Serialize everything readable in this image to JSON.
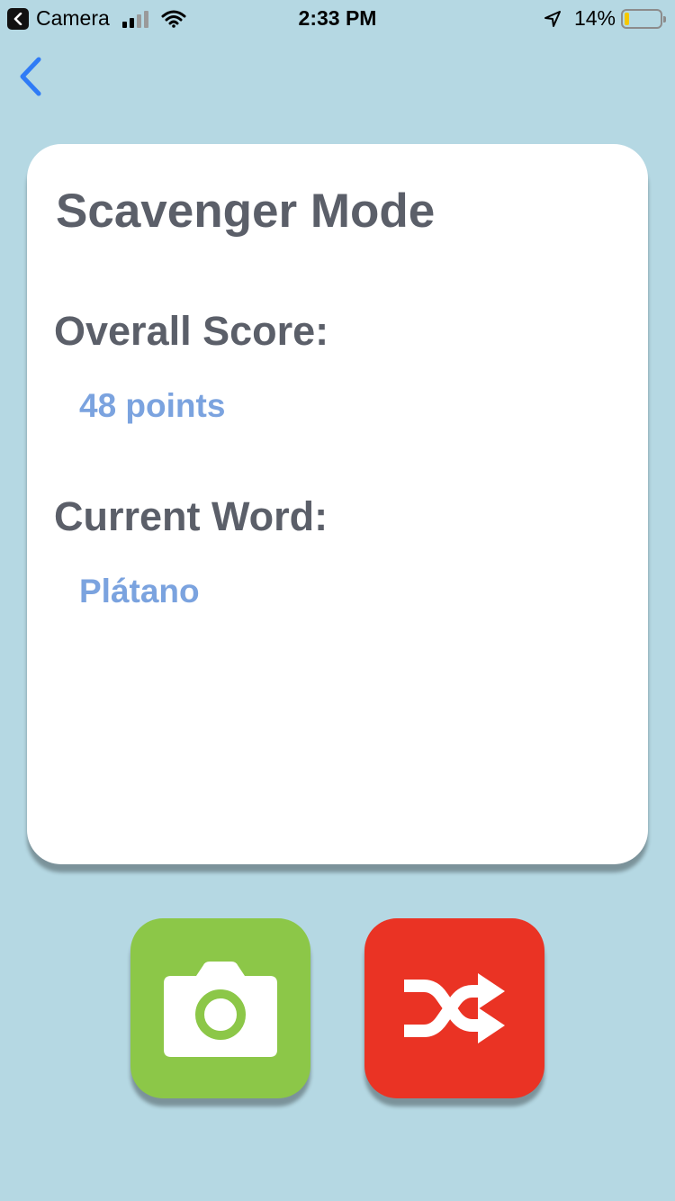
{
  "status_bar": {
    "back_app": "Camera",
    "time": "2:33 PM",
    "battery": "14%",
    "battery_level": 0.14,
    "battery_color": "#f5c800"
  },
  "nav": {
    "back_icon": "chevron-left-icon",
    "accent": "#2f7bf6"
  },
  "card": {
    "title": "Scavenger Mode",
    "score_label": "Overall Score:",
    "score_value": "48 points",
    "word_label": "Current Word:",
    "word_value": "Plátano"
  },
  "actions": {
    "camera": {
      "icon": "camera-icon",
      "color": "#8cc748"
    },
    "shuffle": {
      "icon": "shuffle-icon",
      "color": "#ea3324"
    }
  },
  "colors": {
    "background": "#b5d8e3",
    "heading_text": "#5b5f69",
    "value_text": "#7ba3df"
  }
}
